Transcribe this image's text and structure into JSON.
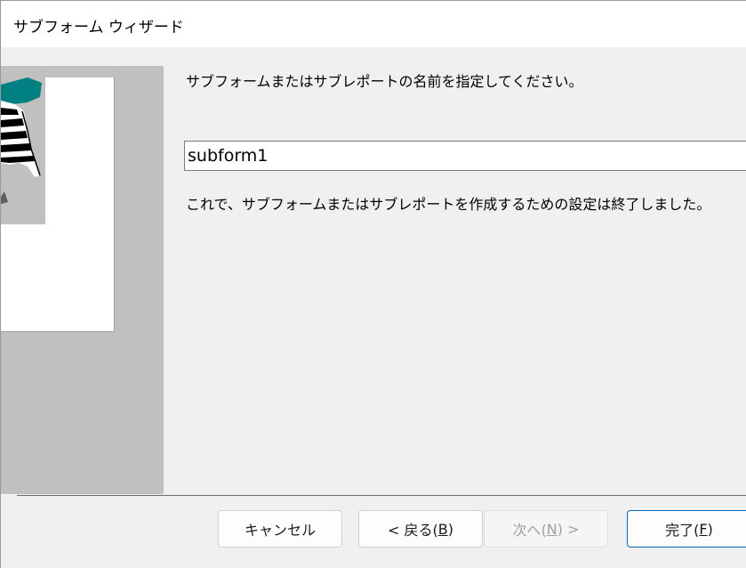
{
  "window": {
    "title": "サブフォーム ウィザード"
  },
  "main": {
    "instruction": "サブフォームまたはサブレポートの名前を指定してください。",
    "name_value": "subform1",
    "finish_message": "これで、サブフォームまたはサブレポートを作成するための設定は終了しました。"
  },
  "buttons": {
    "cancel": {
      "label": "キャンセル"
    },
    "back": {
      "prefix": "< 戻る(",
      "key": "B",
      "suffix": ")"
    },
    "next": {
      "prefix": "次へ(",
      "key": "N",
      "suffix": ") >"
    },
    "finish": {
      "prefix": "完了(",
      "key": "F",
      "suffix": ")"
    }
  },
  "colors": {
    "panel_gray": "#c0c0c0",
    "teal_accent": "#008080",
    "primary_border": "#0067c0"
  },
  "icons": {
    "wizard_graphic": "wizard-illustration-icon"
  }
}
